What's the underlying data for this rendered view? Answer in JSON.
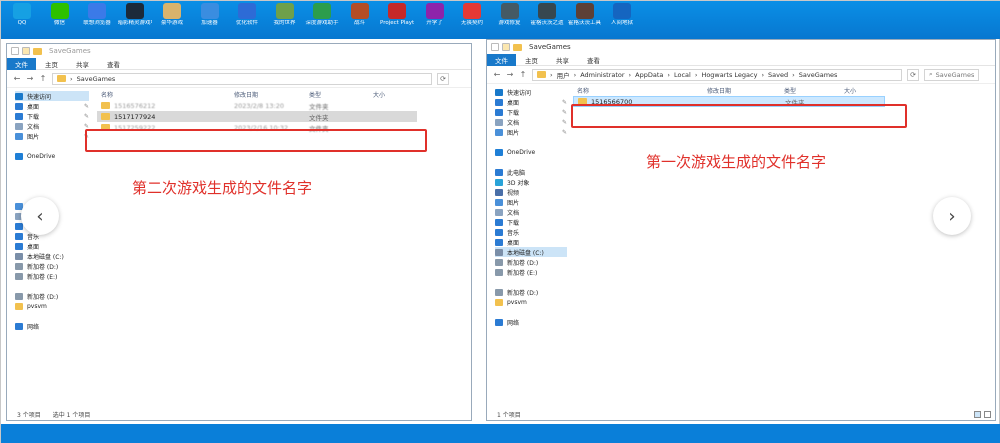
{
  "desktop": {
    "icons": [
      {
        "label": "QQ",
        "color": "#16a0e3"
      },
      {
        "label": "微信",
        "color": "#2dc100"
      },
      {
        "label": "联想浏览器",
        "color": "#3b7ae8"
      },
      {
        "label": "暗影精灵游戏中心",
        "color": "#1c2a3a"
      },
      {
        "label": "豪华游戏",
        "color": "#d9b36c"
      },
      {
        "label": "加速器",
        "color": "#3a8de0"
      },
      {
        "label": "优化软件",
        "color": "#2d6bd6"
      },
      {
        "label": "我的世界",
        "color": "#6ea04b"
      },
      {
        "label": "深度游戏助手",
        "color": "#2c9d4c"
      },
      {
        "label": "战斗",
        "color": "#b34d26"
      },
      {
        "label": "Project Playtime",
        "color": "#c62828"
      },
      {
        "label": "开学了",
        "color": "#8e24aa"
      },
      {
        "label": "无畏契约",
        "color": "#e53935"
      },
      {
        "label": "游戏修复",
        "color": "#455a64"
      },
      {
        "label": "霍格沃茨之遗",
        "color": "#37474f"
      },
      {
        "label": "霍格沃茨工具",
        "color": "#5d4037"
      },
      {
        "label": "人间地狱",
        "color": "#1565c0"
      }
    ]
  },
  "left_window": {
    "title": "SaveGames",
    "ribbon": {
      "file": "文件",
      "home": "主页",
      "share": "共享",
      "view": "查看"
    },
    "address": "SaveGames",
    "columns": {
      "name": "名称",
      "date": "修改日期",
      "type": "类型",
      "size": "大小"
    },
    "files": [
      {
        "name": "1516576212",
        "date": "2023/2/8 13:20",
        "type": "文件夹"
      },
      {
        "name": "1517177924",
        "date": "",
        "type": "文件夹"
      },
      {
        "name": "1517259222",
        "date": "2023/2/16 10:32",
        "type": "文件夹"
      }
    ],
    "sidebar": [
      {
        "label": "快速访问",
        "icon": "star-icon",
        "color": "#1979ca",
        "sel": true
      },
      {
        "label": "桌面",
        "icon": "desktop-icon",
        "color": "#2b7bd3",
        "pin": true
      },
      {
        "label": "下载",
        "icon": "download-icon",
        "color": "#2b7bd3",
        "pin": true
      },
      {
        "label": "文档",
        "icon": "document-icon",
        "color": "#8aa3c0",
        "pin": true
      },
      {
        "label": "图片",
        "icon": "picture-icon",
        "color": "#4a90d9",
        "pin": true
      },
      {
        "label": "",
        "icon": "",
        "color": "#ffffff"
      },
      {
        "label": "OneDrive",
        "icon": "cloud-icon",
        "color": "#1f7fd6"
      },
      {
        "label": "",
        "icon": "",
        "color": "#ffffff"
      },
      {
        "label": "",
        "icon": "",
        "color": "#ffffff"
      },
      {
        "label": "",
        "icon": "",
        "color": "#ffffff"
      },
      {
        "label": "",
        "icon": "",
        "color": "#ffffff"
      },
      {
        "label": "图片",
        "icon": "picture-icon",
        "color": "#4a90d9"
      },
      {
        "label": "文档",
        "icon": "document-icon",
        "color": "#8aa3c0"
      },
      {
        "label": "下载",
        "icon": "download-icon",
        "color": "#2b7bd3"
      },
      {
        "label": "音乐",
        "icon": "music-icon",
        "color": "#2b7bd3"
      },
      {
        "label": "桌面",
        "icon": "desktop-icon",
        "color": "#2b7bd3"
      },
      {
        "label": "本地磁盘 (C:)",
        "icon": "drive-icon",
        "color": "#7a8ea8"
      },
      {
        "label": "新加卷 (D:)",
        "icon": "drive-icon",
        "color": "#8899aa"
      },
      {
        "label": "新加卷 (E:)",
        "icon": "drive-icon",
        "color": "#8899aa"
      },
      {
        "label": "",
        "icon": "",
        "color": "#ffffff"
      },
      {
        "label": "新加卷 (D:)",
        "icon": "drive-icon",
        "color": "#8899aa"
      },
      {
        "label": "pvsvm",
        "icon": "folder-icon",
        "color": "#f2c14e"
      },
      {
        "label": "",
        "icon": "",
        "color": "#ffffff"
      },
      {
        "label": "网络",
        "icon": "network-icon",
        "color": "#2b7bd3"
      }
    ],
    "status": {
      "count": "3 个项目",
      "selected": "选中 1 个项目"
    }
  },
  "right_window": {
    "title": "SaveGames",
    "ribbon": {
      "file": "文件",
      "home": "主页",
      "share": "共享",
      "view": "查看"
    },
    "breadcrumb": [
      "用户",
      "Administrator",
      "AppData",
      "Local",
      "Hogwarts Legacy",
      "Saved",
      "SaveGames"
    ],
    "search_placeholder": "SaveGames",
    "columns": {
      "name": "名称",
      "date": "修改日期",
      "type": "类型",
      "size": "大小"
    },
    "files": [
      {
        "name": "1516566700",
        "date": "",
        "type": "文件夹"
      }
    ],
    "sidebar": [
      {
        "label": "快速访问",
        "icon": "star-icon",
        "color": "#1979ca"
      },
      {
        "label": "桌面",
        "icon": "desktop-icon",
        "color": "#2b7bd3",
        "pin": true
      },
      {
        "label": "下载",
        "icon": "download-icon",
        "color": "#2b7bd3",
        "pin": true
      },
      {
        "label": "文档",
        "icon": "document-icon",
        "color": "#8aa3c0",
        "pin": true
      },
      {
        "label": "图片",
        "icon": "picture-icon",
        "color": "#4a90d9",
        "pin": true
      },
      {
        "label": "",
        "icon": "",
        "color": "#ffffff"
      },
      {
        "label": "OneDrive",
        "icon": "cloud-icon",
        "color": "#1f7fd6"
      },
      {
        "label": "",
        "icon": "",
        "color": "#ffffff"
      },
      {
        "label": "此电脑",
        "icon": "computer-icon",
        "color": "#2b7bd3"
      },
      {
        "label": "3D 对象",
        "icon": "cube-icon",
        "color": "#2aa3d8"
      },
      {
        "label": "视频",
        "icon": "video-icon",
        "color": "#4a6fa8"
      },
      {
        "label": "图片",
        "icon": "picture-icon",
        "color": "#4a90d9"
      },
      {
        "label": "文档",
        "icon": "document-icon",
        "color": "#8aa3c0"
      },
      {
        "label": "下载",
        "icon": "download-icon",
        "color": "#2b7bd3"
      },
      {
        "label": "音乐",
        "icon": "music-icon",
        "color": "#2b7bd3"
      },
      {
        "label": "桌面",
        "icon": "desktop-icon",
        "color": "#2b7bd3"
      },
      {
        "label": "本地磁盘 (C:)",
        "icon": "drive-icon",
        "color": "#7a8ea8",
        "sel": true
      },
      {
        "label": "新加卷 (D:)",
        "icon": "drive-icon",
        "color": "#8899aa"
      },
      {
        "label": "新加卷 (E:)",
        "icon": "drive-icon",
        "color": "#8899aa"
      },
      {
        "label": "",
        "icon": "",
        "color": "#ffffff"
      },
      {
        "label": "新加卷 (D:)",
        "icon": "drive-icon",
        "color": "#8899aa"
      },
      {
        "label": "pvsvm",
        "icon": "folder-icon",
        "color": "#f2c14e"
      },
      {
        "label": "",
        "icon": "",
        "color": "#ffffff"
      },
      {
        "label": "网络",
        "icon": "network-icon",
        "color": "#2b7bd3"
      }
    ],
    "status": {
      "count": "1 个项目"
    }
  },
  "annotations": {
    "left": "第二次游戏生成的文件名字",
    "right": "第一次游戏生成的文件名字",
    "color": "#e0302a"
  },
  "nav": {
    "prev": "‹",
    "next": "›"
  }
}
